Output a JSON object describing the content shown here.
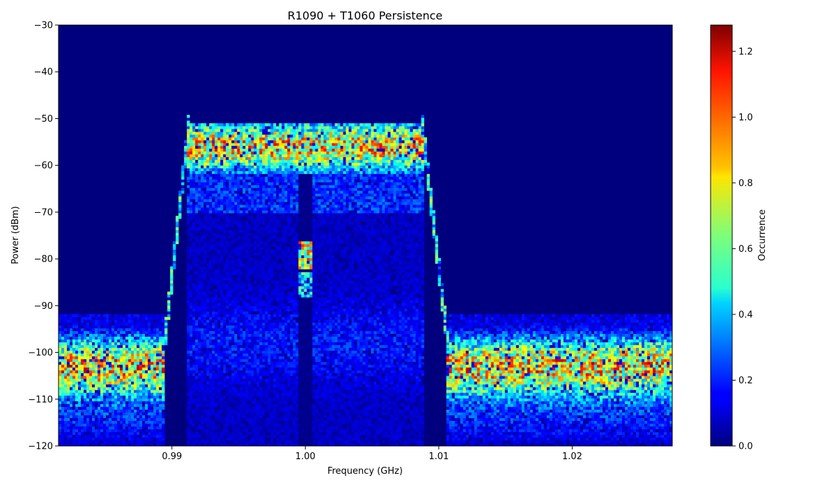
{
  "chart_data": {
    "type": "heatmap",
    "title": "R1090 + T1060 Persistence",
    "xlabel": "Frequency (GHz)",
    "ylabel": "Power (dBm)",
    "colorbar_label": "Occurrence",
    "colormap": "jet",
    "xlim": [
      0.9815,
      1.0275
    ],
    "ylim": [
      -120,
      -30
    ],
    "clim": [
      0,
      1.28
    ],
    "xticks": [
      0.99,
      1.0,
      1.01,
      1.02
    ],
    "xtick_labels": [
      "0.99",
      "1.00",
      "1.01",
      "1.02"
    ],
    "yticks": [
      -30,
      -40,
      -50,
      -60,
      -70,
      -80,
      -90,
      -100,
      -110,
      -120
    ],
    "ytick_labels": [
      "−30",
      "−40",
      "−50",
      "−60",
      "−70",
      "−80",
      "−90",
      "−100",
      "−110",
      "−120"
    ],
    "cticks": [
      0.0,
      0.2,
      0.4,
      0.6,
      0.8,
      1.0,
      1.2
    ],
    "ctick_labels": [
      "0.0",
      "0.2",
      "0.4",
      "0.6",
      "0.8",
      "1.0",
      "1.2"
    ],
    "regions": [
      {
        "freq_range_ghz": [
          0.9815,
          0.9895
        ],
        "power_center_dbm": -103,
        "peak_occurrence": 1.0
      },
      {
        "freq_range_ghz": [
          0.9895,
          0.9912
        ],
        "shape": "rising skirt",
        "power_range_dbm": [
          -96,
          -52
        ]
      },
      {
        "freq_range_ghz": [
          0.9912,
          1.0088
        ],
        "power_plateau_dbm": [
          -62,
          -51
        ],
        "peak_occurrence": 1.0,
        "notch_ghz": 1.0
      },
      {
        "freq_range_ghz": [
          1.0088,
          1.0106
        ],
        "shape": "falling skirt",
        "power_range_dbm": [
          -52,
          -96
        ]
      },
      {
        "freq_range_ghz": [
          1.0106,
          1.0275
        ],
        "power_center_dbm": -103,
        "peak_occurrence": 1.0
      }
    ]
  }
}
